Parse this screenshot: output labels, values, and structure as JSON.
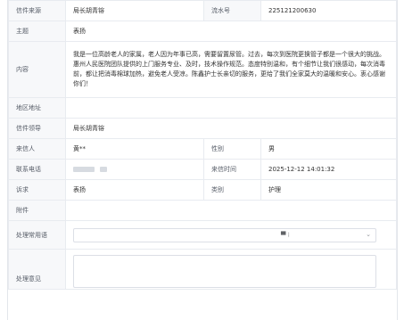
{
  "form": {
    "source_label": "信件来源",
    "source_value": "局长胡青镕",
    "serial_label": "流水号",
    "serial_value": "225121200630",
    "subject_label": "主题",
    "subject_value": "表扬",
    "content_label": "内容",
    "content_value": "我是一位高龄老人的家属，老人因为年事已高，需要留置尿管。过去，每次到医院更换管子都是一个很大的挑战。惠州人民医院团队提供的上门服务专业、及时，技术操作规范。态度特别温和，有个细节让我们很感动，每次消毒前，都让把消毒棉球加热，避免老人受凉。陈鑫护士长亲切的服务，更给了我们全家莫大的温暖和安心。衷心感谢你们！",
    "region_label": "地区地址",
    "region_value": "",
    "leader_label": "信件领导",
    "leader_value": "局长胡青镕",
    "sender_label": "来信人",
    "sender_value": "黄**",
    "gender_label": "性别",
    "gender_value": "男",
    "phone_label": "联系电话",
    "time_label": "来信时间",
    "time_value": "2025-12-12 14:01:32",
    "request_label": "诉求",
    "request_value": "表扬",
    "category_label": "类别",
    "category_value": "护理",
    "attachment_label": "附件",
    "common_label": "处理常用语",
    "opinion_label": "处理意见"
  }
}
